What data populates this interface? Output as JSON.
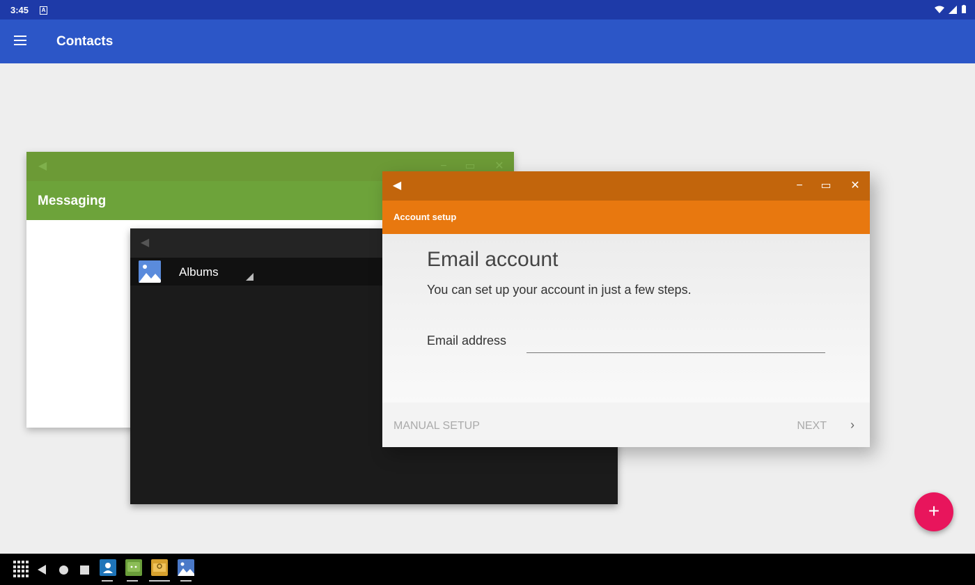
{
  "status": {
    "time": "3:45",
    "badge": "A"
  },
  "appbar": {
    "title": "Contacts"
  },
  "windows": {
    "messaging": {
      "title": "Messaging"
    },
    "gallery": {
      "label": "Albums"
    },
    "email": {
      "header": "Account setup",
      "heading": "Email account",
      "subtitle": "You can set up your account in just a few steps.",
      "field_label": "Email address",
      "field_value": "",
      "manual": "MANUAL SETUP",
      "next": "NEXT"
    }
  },
  "fab": {
    "label": "+"
  },
  "taskbar": {
    "apps": [
      "contacts-app-icon",
      "messaging-app-icon",
      "email-app-icon",
      "gallery-app-icon"
    ]
  }
}
